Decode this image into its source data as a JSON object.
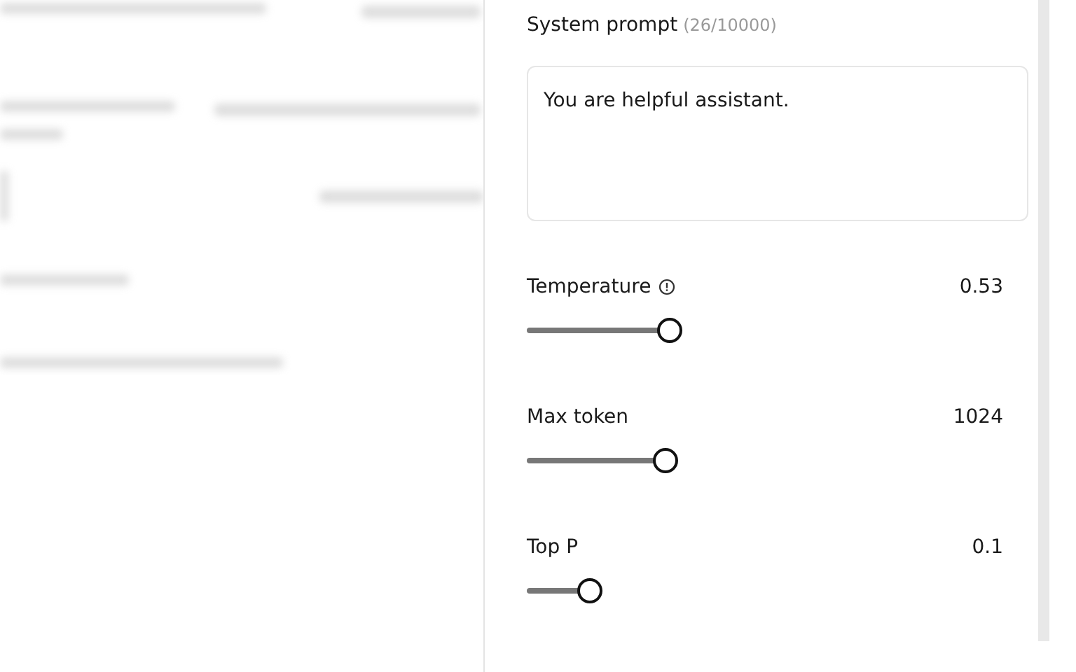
{
  "system_prompt": {
    "label": "System prompt",
    "count": "(26/10000)",
    "value": "You are helpful assistant."
  },
  "parameters": [
    {
      "label": "Temperature",
      "info": true,
      "reading": "0.53",
      "level": 0.29
    },
    {
      "label": "Max token",
      "info": false,
      "reading": "1024",
      "level": 0.28
    },
    {
      "label": "Top P",
      "info": false,
      "reading": "0.1",
      "level": 0.125
    }
  ]
}
